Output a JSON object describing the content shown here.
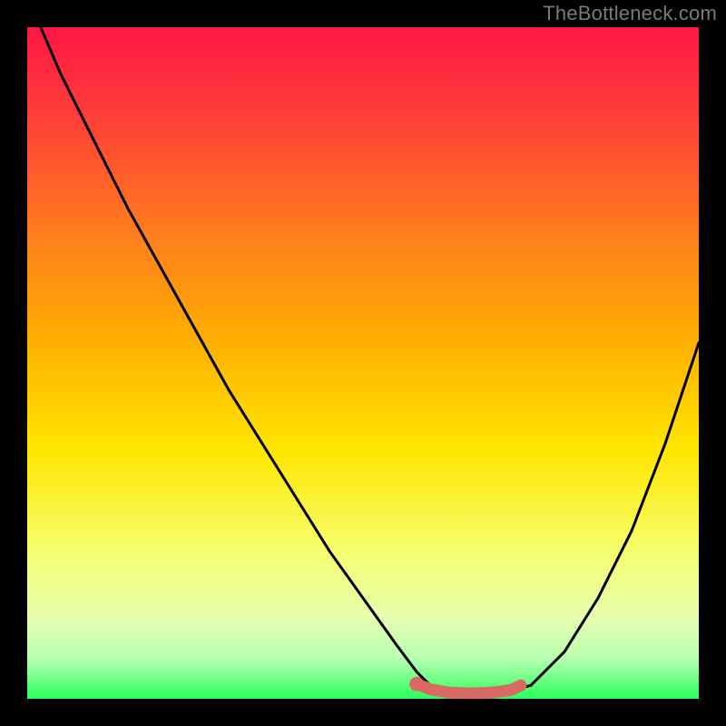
{
  "watermark": "TheBottleneck.com",
  "colors": {
    "frameBackground": "#000000",
    "gradientTop": "#ff1744",
    "gradientUpperMid": "#ff8a00",
    "gradientMid": "#ffe600",
    "gradientLowerMid": "#f3ff8a",
    "gradientBottom": "#2aff5a",
    "curveStroke": "#000000",
    "markerFill": "#d86a63",
    "watermarkText": "#7a7a7a"
  },
  "chart_data": {
    "type": "line",
    "title": "",
    "xlabel": "",
    "ylabel": "",
    "xlim": [
      0,
      100
    ],
    "ylim": [
      0,
      100
    ],
    "grid": false,
    "legend": false,
    "series": [
      {
        "name": "bottleneck-curve",
        "x": [
          0,
          2,
          5,
          10,
          15,
          20,
          25,
          30,
          35,
          40,
          45,
          50,
          55,
          58,
          60,
          62,
          65,
          70,
          75,
          80,
          85,
          90,
          95,
          100
        ],
        "y": [
          108,
          100,
          93,
          83,
          73,
          64,
          55,
          46,
          38,
          30,
          22,
          15,
          8,
          4,
          2,
          1,
          0.5,
          0.5,
          2,
          7,
          15,
          25,
          38,
          53
        ]
      },
      {
        "name": "optimal-marker",
        "x": [
          58,
          60,
          63,
          66,
          69,
          72,
          73.5
        ],
        "y": [
          2.2,
          1.4,
          0.9,
          0.8,
          0.9,
          1.3,
          2.0
        ]
      }
    ],
    "annotations": []
  }
}
